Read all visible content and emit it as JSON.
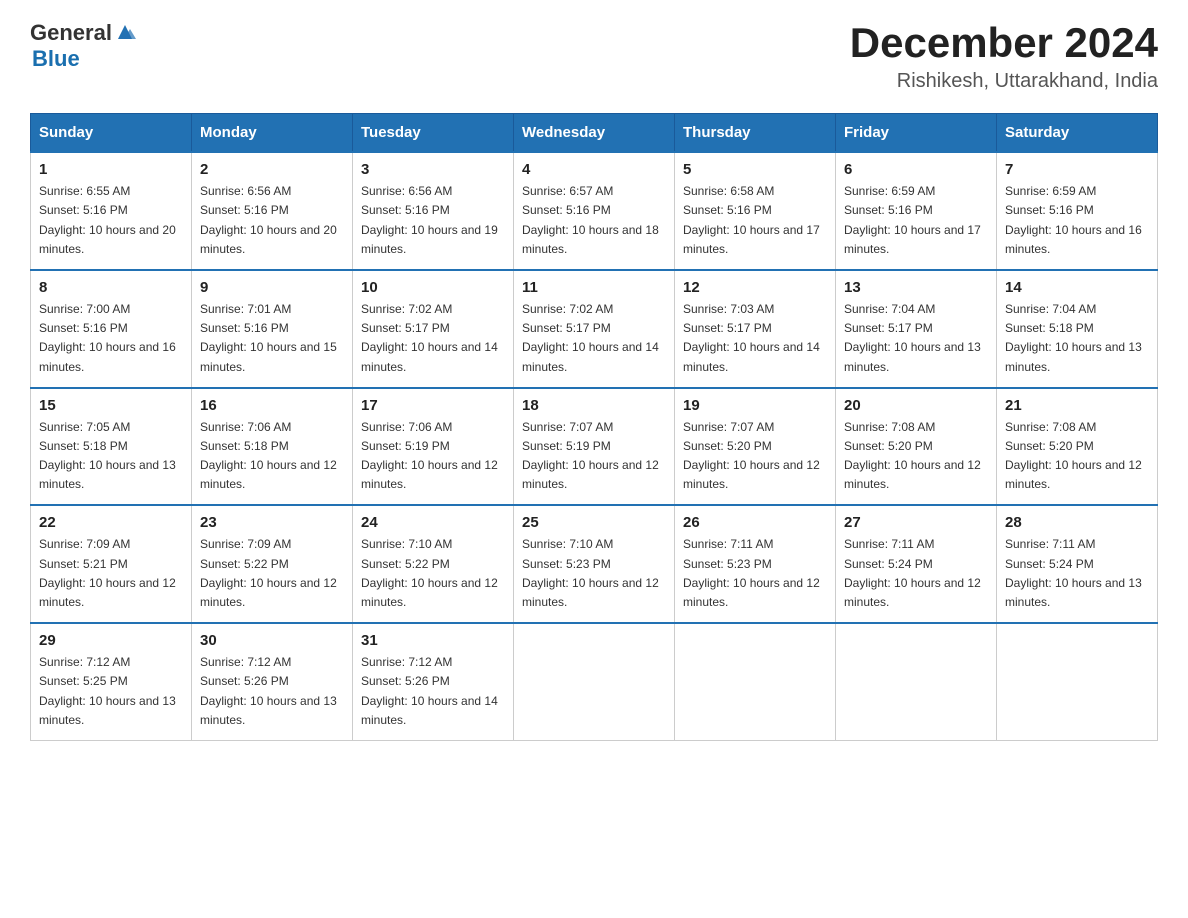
{
  "header": {
    "logo_general": "General",
    "logo_blue": "Blue",
    "month_year": "December 2024",
    "location": "Rishikesh, Uttarakhand, India"
  },
  "days_of_week": [
    "Sunday",
    "Monday",
    "Tuesday",
    "Wednesday",
    "Thursday",
    "Friday",
    "Saturday"
  ],
  "weeks": [
    [
      {
        "day": "1",
        "sunrise": "6:55 AM",
        "sunset": "5:16 PM",
        "daylight": "10 hours and 20 minutes."
      },
      {
        "day": "2",
        "sunrise": "6:56 AM",
        "sunset": "5:16 PM",
        "daylight": "10 hours and 20 minutes."
      },
      {
        "day": "3",
        "sunrise": "6:56 AM",
        "sunset": "5:16 PM",
        "daylight": "10 hours and 19 minutes."
      },
      {
        "day": "4",
        "sunrise": "6:57 AM",
        "sunset": "5:16 PM",
        "daylight": "10 hours and 18 minutes."
      },
      {
        "day": "5",
        "sunrise": "6:58 AM",
        "sunset": "5:16 PM",
        "daylight": "10 hours and 17 minutes."
      },
      {
        "day": "6",
        "sunrise": "6:59 AM",
        "sunset": "5:16 PM",
        "daylight": "10 hours and 17 minutes."
      },
      {
        "day": "7",
        "sunrise": "6:59 AM",
        "sunset": "5:16 PM",
        "daylight": "10 hours and 16 minutes."
      }
    ],
    [
      {
        "day": "8",
        "sunrise": "7:00 AM",
        "sunset": "5:16 PM",
        "daylight": "10 hours and 16 minutes."
      },
      {
        "day": "9",
        "sunrise": "7:01 AM",
        "sunset": "5:16 PM",
        "daylight": "10 hours and 15 minutes."
      },
      {
        "day": "10",
        "sunrise": "7:02 AM",
        "sunset": "5:17 PM",
        "daylight": "10 hours and 14 minutes."
      },
      {
        "day": "11",
        "sunrise": "7:02 AM",
        "sunset": "5:17 PM",
        "daylight": "10 hours and 14 minutes."
      },
      {
        "day": "12",
        "sunrise": "7:03 AM",
        "sunset": "5:17 PM",
        "daylight": "10 hours and 14 minutes."
      },
      {
        "day": "13",
        "sunrise": "7:04 AM",
        "sunset": "5:17 PM",
        "daylight": "10 hours and 13 minutes."
      },
      {
        "day": "14",
        "sunrise": "7:04 AM",
        "sunset": "5:18 PM",
        "daylight": "10 hours and 13 minutes."
      }
    ],
    [
      {
        "day": "15",
        "sunrise": "7:05 AM",
        "sunset": "5:18 PM",
        "daylight": "10 hours and 13 minutes."
      },
      {
        "day": "16",
        "sunrise": "7:06 AM",
        "sunset": "5:18 PM",
        "daylight": "10 hours and 12 minutes."
      },
      {
        "day": "17",
        "sunrise": "7:06 AM",
        "sunset": "5:19 PM",
        "daylight": "10 hours and 12 minutes."
      },
      {
        "day": "18",
        "sunrise": "7:07 AM",
        "sunset": "5:19 PM",
        "daylight": "10 hours and 12 minutes."
      },
      {
        "day": "19",
        "sunrise": "7:07 AM",
        "sunset": "5:20 PM",
        "daylight": "10 hours and 12 minutes."
      },
      {
        "day": "20",
        "sunrise": "7:08 AM",
        "sunset": "5:20 PM",
        "daylight": "10 hours and 12 minutes."
      },
      {
        "day": "21",
        "sunrise": "7:08 AM",
        "sunset": "5:20 PM",
        "daylight": "10 hours and 12 minutes."
      }
    ],
    [
      {
        "day": "22",
        "sunrise": "7:09 AM",
        "sunset": "5:21 PM",
        "daylight": "10 hours and 12 minutes."
      },
      {
        "day": "23",
        "sunrise": "7:09 AM",
        "sunset": "5:22 PM",
        "daylight": "10 hours and 12 minutes."
      },
      {
        "day": "24",
        "sunrise": "7:10 AM",
        "sunset": "5:22 PM",
        "daylight": "10 hours and 12 minutes."
      },
      {
        "day": "25",
        "sunrise": "7:10 AM",
        "sunset": "5:23 PM",
        "daylight": "10 hours and 12 minutes."
      },
      {
        "day": "26",
        "sunrise": "7:11 AM",
        "sunset": "5:23 PM",
        "daylight": "10 hours and 12 minutes."
      },
      {
        "day": "27",
        "sunrise": "7:11 AM",
        "sunset": "5:24 PM",
        "daylight": "10 hours and 12 minutes."
      },
      {
        "day": "28",
        "sunrise": "7:11 AM",
        "sunset": "5:24 PM",
        "daylight": "10 hours and 13 minutes."
      }
    ],
    [
      {
        "day": "29",
        "sunrise": "7:12 AM",
        "sunset": "5:25 PM",
        "daylight": "10 hours and 13 minutes."
      },
      {
        "day": "30",
        "sunrise": "7:12 AM",
        "sunset": "5:26 PM",
        "daylight": "10 hours and 13 minutes."
      },
      {
        "day": "31",
        "sunrise": "7:12 AM",
        "sunset": "5:26 PM",
        "daylight": "10 hours and 14 minutes."
      },
      null,
      null,
      null,
      null
    ]
  ],
  "labels": {
    "sunrise_prefix": "Sunrise: ",
    "sunset_prefix": "Sunset: ",
    "daylight_prefix": "Daylight: "
  }
}
